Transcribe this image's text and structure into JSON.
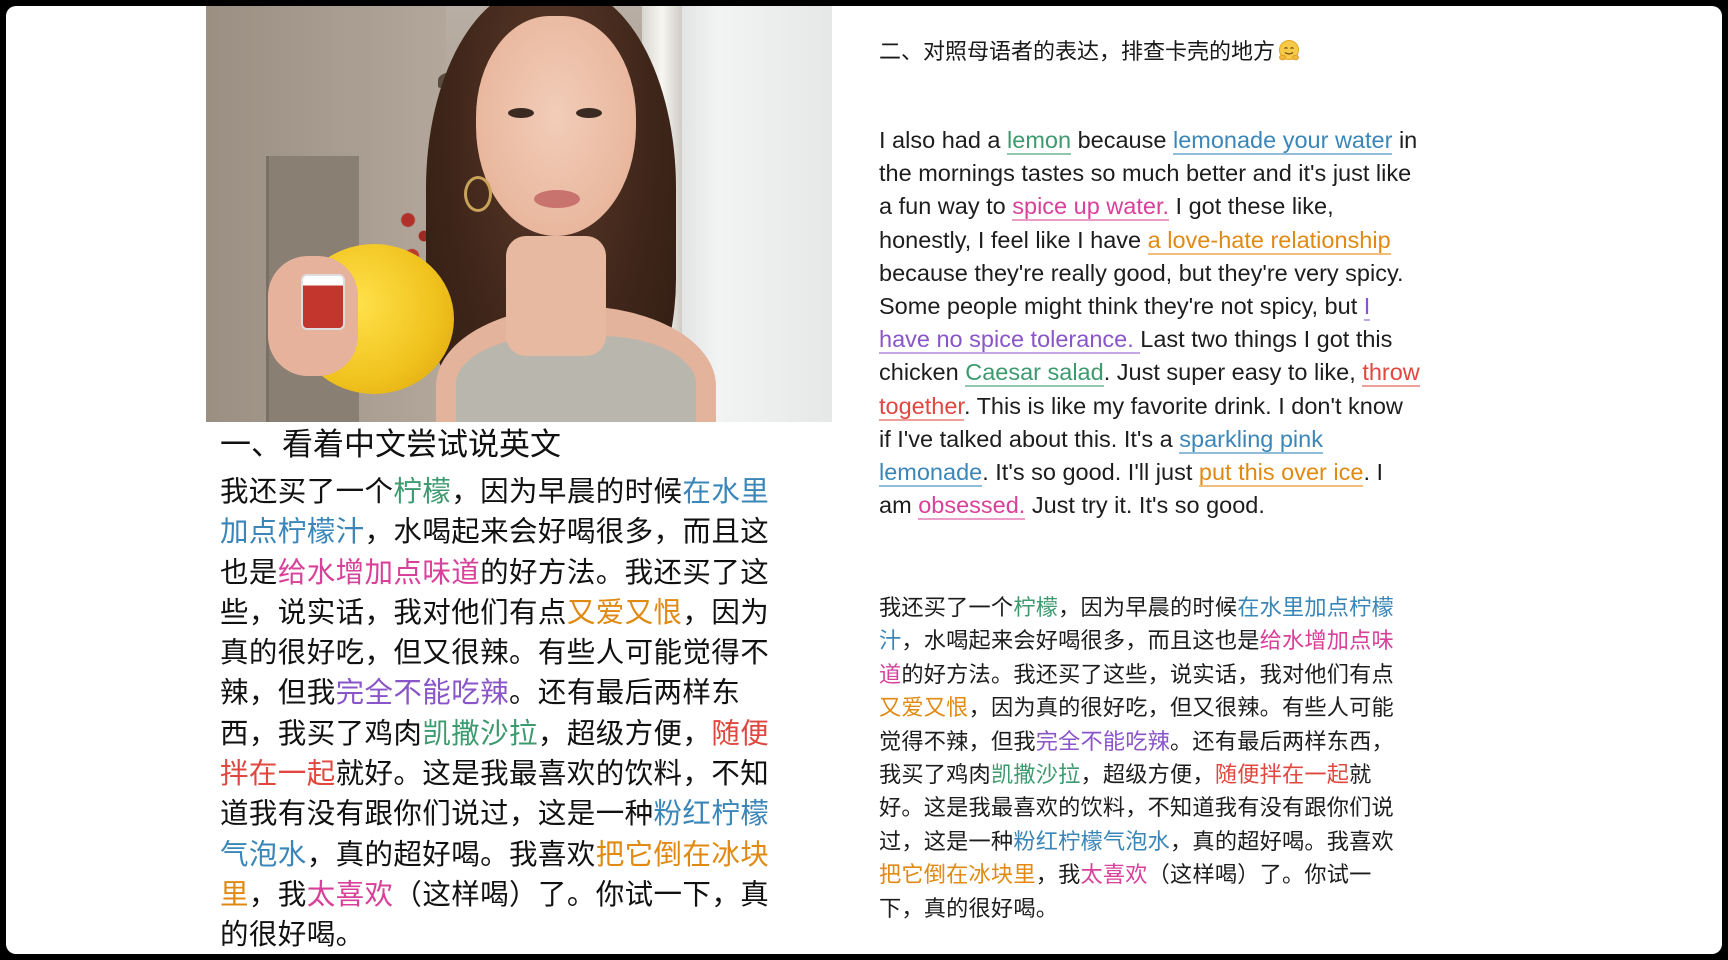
{
  "left": {
    "title": "一、看着中文尝试说英文",
    "lines": [
      [
        {
          "t": "我还买了一个"
        },
        {
          "t": "柠檬",
          "c": "green"
        },
        {
          "t": "，因为早晨的时候"
        },
        {
          "t": "在水里",
          "c": "blue"
        }
      ],
      [
        {
          "t": "加点柠檬汁",
          "c": "blue"
        },
        {
          "t": "，水喝起来会好喝很多，而且这"
        }
      ],
      [
        {
          "t": "也是"
        },
        {
          "t": "给水增加点味道",
          "c": "pink"
        },
        {
          "t": "的好方法。我还买了这"
        }
      ],
      [
        {
          "t": "些，说实话，我对他们有点"
        },
        {
          "t": "又爱又恨",
          "c": "orange"
        },
        {
          "t": "，因为"
        }
      ],
      [
        {
          "t": "真的很好吃，但又很辣。有些人可能觉得不"
        }
      ],
      [
        {
          "t": "辣，但我"
        },
        {
          "t": "完全不能吃辣",
          "c": "purple"
        },
        {
          "t": "。还有最后两样东"
        }
      ],
      [
        {
          "t": "西，我买了鸡肉"
        },
        {
          "t": "凯撒沙拉",
          "c": "green"
        },
        {
          "t": "，超级方便，"
        },
        {
          "t": "随便",
          "c": "red"
        }
      ],
      [
        {
          "t": "拌在一起",
          "c": "red"
        },
        {
          "t": "就好。这是我最喜欢的饮料，不知"
        }
      ],
      [
        {
          "t": "道我有没有跟你们说过，这是一种"
        },
        {
          "t": "粉红柠檬",
          "c": "blue"
        }
      ],
      [
        {
          "t": "气泡水",
          "c": "blue"
        },
        {
          "t": "，真的超好喝。我喜欢"
        },
        {
          "t": "把它倒在冰块",
          "c": "orange"
        }
      ],
      [
        {
          "t": "里",
          "c": "orange"
        },
        {
          "t": "，我"
        },
        {
          "t": "太喜欢",
          "c": "pink"
        },
        {
          "t": "（这样喝）了。你试一下，真"
        }
      ],
      [
        {
          "t": "的很好喝。"
        }
      ]
    ]
  },
  "right": {
    "title": "二、对照母语者的表达，排查卡壳的地方",
    "english_lines": [
      [
        {
          "t": "I also had a "
        },
        {
          "t": "lemon",
          "c": "green"
        },
        {
          "t": " because "
        },
        {
          "t": "lemonade your water",
          "c": "blue"
        },
        {
          "t": " in"
        }
      ],
      [
        {
          "t": "the mornings tastes so much better and it's just like"
        }
      ],
      [
        {
          "t": "a fun way to "
        },
        {
          "t": "spice up water.",
          "c": "pink"
        },
        {
          "t": " I got these like,"
        }
      ],
      [
        {
          "t": "honestly, I feel like I have "
        },
        {
          "t": "a love-hate relationship ",
          "c": "orange"
        }
      ],
      [
        {
          "t": "because they're really good, but they're very spicy."
        }
      ],
      [
        {
          "t": "Some people might think they're not spicy, but "
        },
        {
          "t": "I",
          "c": "purple"
        }
      ],
      [
        {
          "t": "have no spice tolerance. ",
          "c": "purple"
        },
        {
          "t": "Last two things I got this"
        }
      ],
      [
        {
          "t": "chicken "
        },
        {
          "t": "Caesar salad",
          "c": "green"
        },
        {
          "t": ". Just super easy to like, "
        },
        {
          "t": "throw ",
          "c": "red"
        }
      ],
      [
        {
          "t": "together",
          "c": "red"
        },
        {
          "t": ". This is like my favorite drink. I don't know"
        }
      ],
      [
        {
          "t": "if I've talked about this. It's a "
        },
        {
          "t": "sparkling pink ",
          "c": "blue"
        }
      ],
      [
        {
          "t": "lemonade",
          "c": "blue"
        },
        {
          "t": ". It's so good. I'll just "
        },
        {
          "t": "put this over ice",
          "c": "orange"
        },
        {
          "t": ". I"
        }
      ],
      [
        {
          "t": "am "
        },
        {
          "t": "obsessed.",
          "c": "pink"
        },
        {
          "t": " Just try it. It's so good."
        }
      ]
    ],
    "chinese_lines": [
      [
        {
          "t": "我还买了一个"
        },
        {
          "t": "柠檬",
          "c": "green"
        },
        {
          "t": "，因为早晨的时候"
        },
        {
          "t": "在水里加点柠檬",
          "c": "blue"
        }
      ],
      [
        {
          "t": "汁",
          "c": "blue"
        },
        {
          "t": "，水喝起来会好喝很多，而且这也是"
        },
        {
          "t": "给水增加点味",
          "c": "pink"
        }
      ],
      [
        {
          "t": "道",
          "c": "pink"
        },
        {
          "t": "的好方法。我还买了这些，说实话，我对他们有点"
        }
      ],
      [
        {
          "t": "又爱又恨",
          "c": "orange"
        },
        {
          "t": "，因为真的很好吃，但又很辣。有些人可能"
        }
      ],
      [
        {
          "t": "觉得不辣，但我"
        },
        {
          "t": "完全不能吃辣",
          "c": "purple"
        },
        {
          "t": "。还有最后两样东西，"
        }
      ],
      [
        {
          "t": "我买了鸡肉"
        },
        {
          "t": "凯撒沙拉",
          "c": "green"
        },
        {
          "t": "，超级方便，"
        },
        {
          "t": "随便拌在一起",
          "c": "red"
        },
        {
          "t": "就"
        }
      ],
      [
        {
          "t": "好。这是我最喜欢的饮料，不知道我有没有跟你们说"
        }
      ],
      [
        {
          "t": "过，这是一种"
        },
        {
          "t": "粉红柠檬气泡水",
          "c": "blue"
        },
        {
          "t": "，真的超好喝。我喜欢"
        }
      ],
      [
        {
          "t": "把它倒在冰块里",
          "c": "orange"
        },
        {
          "t": "，我"
        },
        {
          "t": "太喜欢",
          "c": "pink"
        },
        {
          "t": "（这样喝）了。你试一"
        }
      ],
      [
        {
          "t": "下，真的很好喝。"
        }
      ]
    ]
  },
  "highlight_colors": {
    "green": "#3d9a6e",
    "blue": "#3b86b8",
    "pink": "#d9409a",
    "orange": "#e08a13",
    "purple": "#8a55c8",
    "red": "#e0473f"
  }
}
